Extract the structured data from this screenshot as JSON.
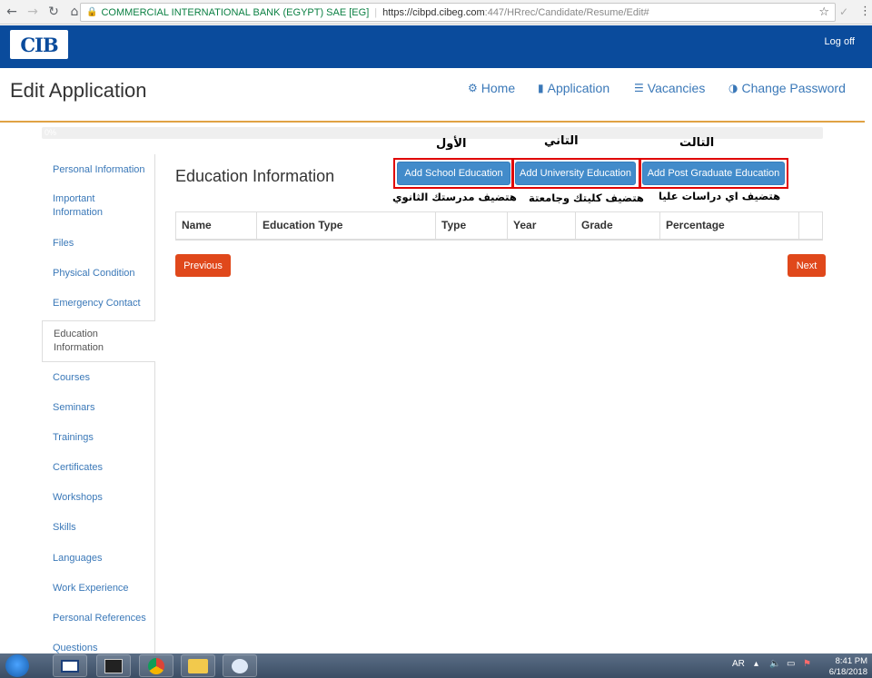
{
  "browser": {
    "back_icon": "arrow-left-icon",
    "cert_name": "COMMERCIAL INTERNATIONAL BANK (EGYPT) SAE [EG]",
    "url_host": "https://cibpd.cibeg.com",
    "url_path": ":447/HRrec/Candidate/Resume/Edit#"
  },
  "topbar": {
    "logo_text": "CIB",
    "logoff_label": "Log off"
  },
  "header": {
    "title": "Edit Application",
    "nav": [
      {
        "label": "Home",
        "icon": "gear-icon"
      },
      {
        "label": "Application",
        "icon": "file-icon"
      },
      {
        "label": "Vacancies",
        "icon": "list-icon"
      },
      {
        "label": "Change Password",
        "icon": "half-circle-icon"
      }
    ],
    "progress_text": "0%",
    "progress_value": 0
  },
  "sidebar": {
    "items": [
      {
        "label": "Personal Information"
      },
      {
        "label": "Important Information"
      },
      {
        "label": "Files"
      },
      {
        "label": "Physical Condition"
      },
      {
        "label": "Emergency Contact"
      },
      {
        "label": "Education Information"
      },
      {
        "label": "Courses"
      },
      {
        "label": "Seminars"
      },
      {
        "label": "Trainings"
      },
      {
        "label": "Certificates"
      },
      {
        "label": "Workshops"
      },
      {
        "label": "Skills"
      },
      {
        "label": "Languages"
      },
      {
        "label": "Work Experience"
      },
      {
        "label": "Personal References"
      },
      {
        "label": "Questions"
      }
    ],
    "active_index": 5
  },
  "main": {
    "section_title": "Education Information",
    "buttons": {
      "school": "Add School Education",
      "university": "Add University Education",
      "postgrad": "Add Post Graduate Education"
    },
    "annotations": {
      "first": "الأول",
      "second": "التاني",
      "third": "التالت",
      "school_note": "هتضيف مدرستك الثانوي",
      "university_note": "هتضيف كليتك وجامعتة",
      "postgrad_note": "هتضيف اي دراسات عليا"
    },
    "table": {
      "columns": [
        "Name",
        "Education Type",
        "Type",
        "Year",
        "Grade",
        "Percentage",
        ""
      ]
    },
    "previous_label": "Previous",
    "next_label": "Next"
  },
  "taskbar": {
    "lang": "AR",
    "time": "8:41 PM",
    "date": "6/18/2018"
  },
  "colors": {
    "brand": "#0a4b9c",
    "accent": "#e0a244",
    "primary_button": "#428bca",
    "nav_button": "#e0481b",
    "highlight": "#e00000"
  }
}
